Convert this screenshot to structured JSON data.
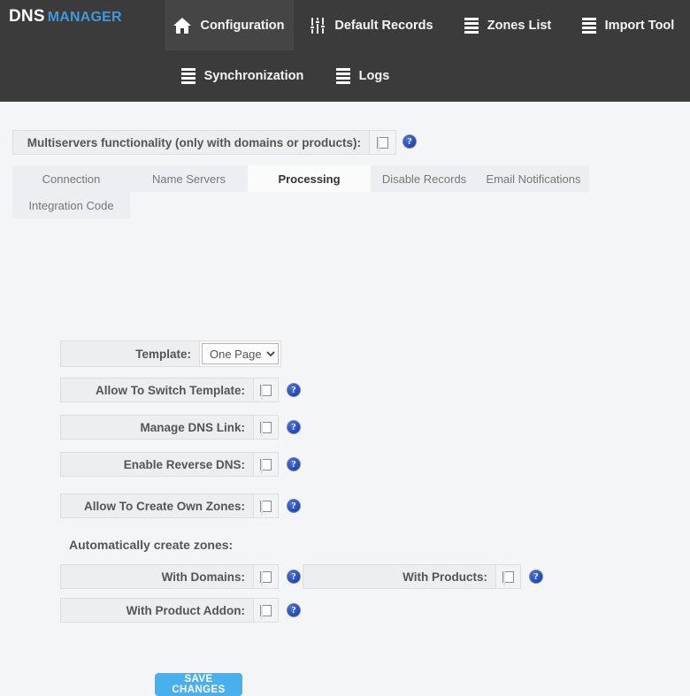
{
  "brand": {
    "primary": "DNS",
    "secondary": "MANAGER",
    "accent_color": "#3d9ae0"
  },
  "nav": {
    "items": [
      {
        "label": "Configuration",
        "icon": "home-icon",
        "active": true
      },
      {
        "label": "Default Records",
        "icon": "sliders-icon",
        "active": false
      },
      {
        "label": "Zones List",
        "icon": "server-icon",
        "active": false
      },
      {
        "label": "Import Tool",
        "icon": "server-icon",
        "active": false
      },
      {
        "label": "Synchronization",
        "icon": "server-icon",
        "active": false
      },
      {
        "label": "Logs",
        "icon": "server-icon",
        "active": false
      }
    ]
  },
  "multiservers": {
    "label": "Multiservers functionality (only with domains or products):",
    "checked": false,
    "help": "?"
  },
  "tabs": {
    "row1": [
      {
        "label": "Connection",
        "active": false
      },
      {
        "label": "Name Servers",
        "active": false
      },
      {
        "label": "Processing",
        "active": true
      },
      {
        "label": "Disable Records",
        "active": false
      },
      {
        "label": "Email Notifications",
        "active": false
      }
    ],
    "row2": [
      {
        "label": "Integration Code",
        "active": false
      }
    ]
  },
  "form": {
    "template": {
      "label": "Template:",
      "value": "One Page",
      "options": [
        "One Page"
      ]
    },
    "rows": [
      {
        "label": "Allow To Switch Template:",
        "checked": false,
        "help": "?"
      },
      {
        "label": "Manage DNS Link:",
        "checked": false,
        "help": "?"
      },
      {
        "label": "Enable Reverse DNS:",
        "checked": false,
        "help": "?"
      },
      {
        "label": "Allow To Create Own Zones:",
        "checked": false,
        "help": "?"
      }
    ],
    "section_title": "Automatically create zones:",
    "auto_rows": [
      {
        "label": "With Domains:",
        "checked": false,
        "help": "?"
      },
      {
        "label": "With Products:",
        "checked": false,
        "help": "?"
      },
      {
        "label": "With Product Addon:",
        "checked": false,
        "help": "?"
      }
    ]
  },
  "actions": {
    "save_label": "SAVE CHANGES",
    "save_color": "#49b0ee"
  }
}
